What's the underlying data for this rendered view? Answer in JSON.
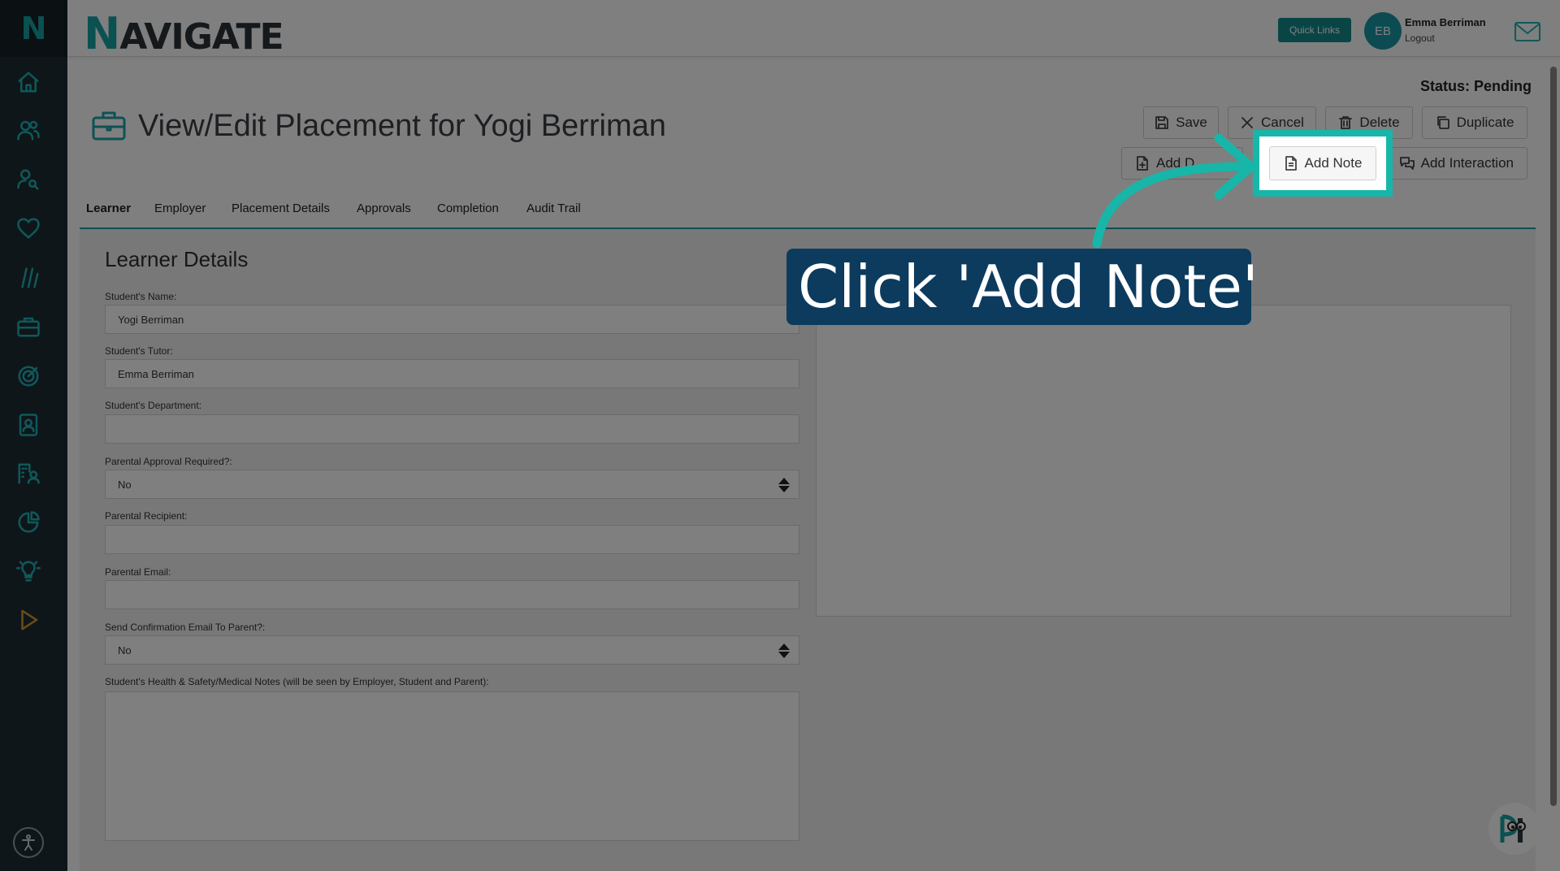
{
  "app": {
    "brand_first": "N",
    "brand_rest": "AVIGATE",
    "side_logo": "N"
  },
  "header": {
    "quick_links": "Quick Links",
    "avatar_initials": "EB",
    "user_name": "Emma Berriman",
    "logout": "Logout"
  },
  "sidebar": {
    "icons": [
      "home-icon",
      "users-icon",
      "user-search-icon",
      "heart-icon",
      "slashes-icon",
      "briefcase-icon",
      "target-icon",
      "contact-card-icon",
      "building-user-icon",
      "pie-chart-icon",
      "lightbulb-icon",
      "play-icon"
    ]
  },
  "page": {
    "status": "Status: Pending",
    "title": "View/Edit Placement for Yogi Berriman"
  },
  "toolbar": {
    "save": "Save",
    "cancel": "Cancel",
    "delete": "Delete",
    "duplicate": "Duplicate",
    "add_document": "Add D",
    "add_note": "Add Note",
    "add_interaction": "Add Interaction"
  },
  "tabs": [
    "Learner",
    "Employer",
    "Placement Details",
    "Approvals",
    "Completion",
    "Audit Trail"
  ],
  "form": {
    "section_title": "Learner Details",
    "student_name_label": "Student's Name:",
    "student_name": "Yogi Berriman",
    "tutor_label": "Student's Tutor:",
    "tutor": "Emma Berriman",
    "department_label": "Student's Department:",
    "department": "",
    "parental_approval_label": "Parental Approval Required?:",
    "parental_approval": "No",
    "parental_recipient_label": "Parental Recipient:",
    "parental_recipient": "",
    "parental_email_label": "Parental Email:",
    "parental_email": "",
    "send_confirmation_label": "Send Confirmation Email To Parent?:",
    "send_confirmation": "No",
    "health_notes_label": "Student's Health & Safety/Medical Notes (will be seen by Employer, Student and Parent):"
  },
  "overlay": {
    "callout_text": "Click 'Add Note'",
    "highlight_color": "#17b6a8",
    "callout_color": "#0c3b5e"
  }
}
